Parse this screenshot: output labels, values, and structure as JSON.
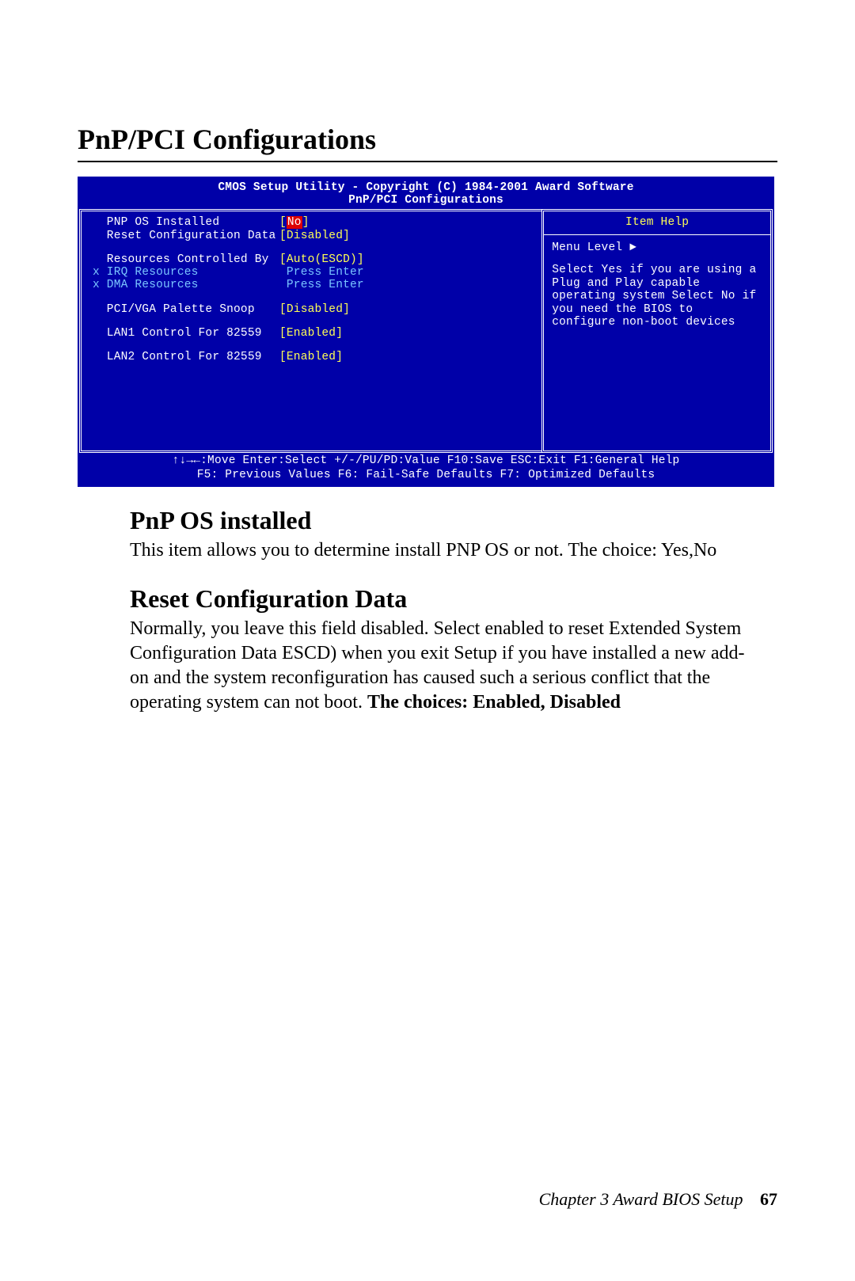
{
  "pageTitle": "PnP/PCI Configurations",
  "bios": {
    "title1": "CMOS Setup Utility - Copyright (C) 1984-2001 Award Software",
    "title2": "PnP/PCI Configurations",
    "rows": [
      {
        "label": "  PNP OS Installed",
        "value_pre": "[",
        "value_hl": "No",
        "value_post": "]",
        "disabled": false,
        "highlight": true
      },
      {
        "label": "  Reset Configuration Data",
        "value": "[Disabled]",
        "disabled": false
      },
      {
        "spacer": true
      },
      {
        "label": "  Resources Controlled By",
        "value": "[Auto(ESCD)]",
        "disabled": false
      },
      {
        "label": "x IRQ Resources",
        "value": " Press Enter",
        "disabled": true
      },
      {
        "label": "x DMA Resources",
        "value": " Press Enter",
        "disabled": true
      },
      {
        "spacer": true
      },
      {
        "label": "  PCI/VGA Palette Snoop",
        "value": "[Disabled]",
        "disabled": false
      },
      {
        "spacer": true
      },
      {
        "label": "  LAN1 Control For 82559",
        "value": "[Enabled]",
        "disabled": false
      },
      {
        "spacer": true
      },
      {
        "label": "  LAN2 Control For 82559",
        "value": "[Enabled]",
        "disabled": false
      }
    ],
    "help": {
      "title": "Item Help",
      "menuLevel": "Menu Level   ►",
      "text": "Select Yes if you are using a Plug and Play capable operating system Select No if you need the BIOS to configure non-boot devices"
    },
    "footer1": "↑↓→←:Move  Enter:Select  +/-/PU/PD:Value  F10:Save  ESC:Exit  F1:General Help",
    "footer2": "F5: Previous Values    F6: Fail-Safe Defaults    F7: Optimized Defaults"
  },
  "sections": [
    {
      "heading": "PnP OS installed",
      "body": "This item allows you to determine install PNP OS or not. The choice: Yes,No"
    },
    {
      "heading": "Reset Configuration Data",
      "bodyPrefix": "Normally, you leave this field disabled. Select enabled to reset Extended System Configuration Data ESCD) when you exit Setup if you have installed a new add-on and the system reconfiguration has caused such a serious conflict that the operating system can not boot. ",
      "bodyBold": "The choices: Enabled, Disabled"
    }
  ],
  "footer": {
    "chapter": "Chapter 3 Award BIOS Setup",
    "page": "67"
  }
}
